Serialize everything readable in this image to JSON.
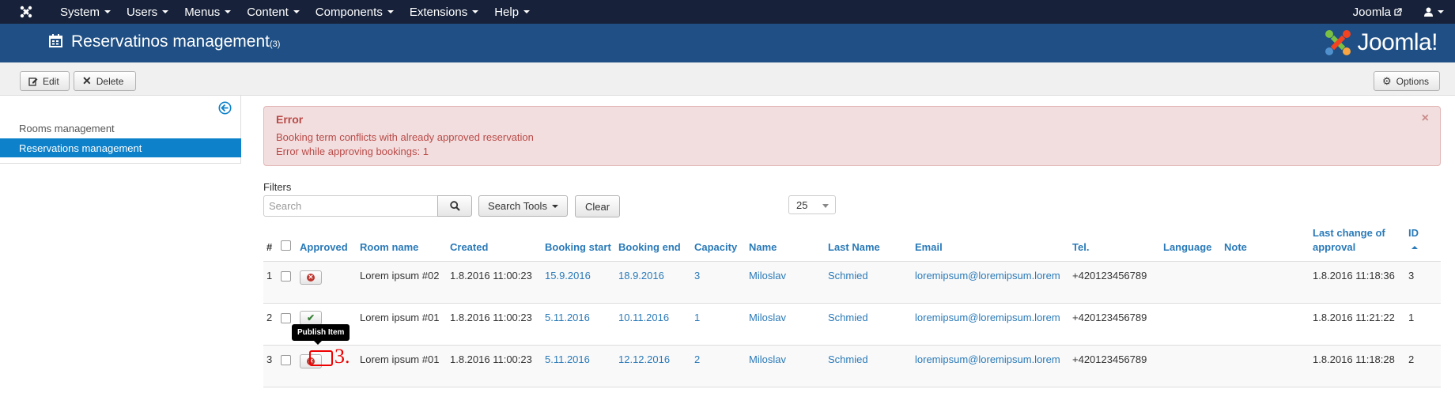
{
  "navbar": {
    "menu": [
      "System",
      "Users",
      "Menus",
      "Content",
      "Components",
      "Extensions",
      "Help"
    ],
    "site_link": "Joomla",
    "user_icon": "user-icon"
  },
  "header": {
    "title": "Reservatinos management",
    "count": "(3)",
    "brand": "Joomla!"
  },
  "toolbar": {
    "edit_label": "Edit",
    "delete_label": "Delete",
    "options_label": "Options"
  },
  "sidebar": {
    "items": [
      {
        "label": "Rooms management",
        "active": false
      },
      {
        "label": "Reservations management",
        "active": true
      }
    ]
  },
  "alert": {
    "heading": "Error",
    "messages": [
      "Booking term conflicts with already approved reservation",
      "Error while approving bookings: 1"
    ],
    "close": "×"
  },
  "filters": {
    "label": "Filters",
    "search_placeholder": "Search",
    "search_tools_label": "Search Tools",
    "clear_label": "Clear",
    "limit_value": "25"
  },
  "table": {
    "headers": [
      "#",
      "",
      "Approved",
      "Room name",
      "Created",
      "Booking start",
      "Booking end",
      "Capacity",
      "Name",
      "Last Name",
      "Email",
      "Tel.",
      "Language",
      "Note",
      "Last change of approval",
      "ID"
    ],
    "rows": [
      {
        "num": "1",
        "approved": false,
        "room": "Lorem ipsum #02",
        "created": "1.8.2016 11:00:23",
        "start": "15.9.2016",
        "end": "18.9.2016",
        "capacity": "3",
        "name": "Miloslav",
        "last_name": "Schmied",
        "email": "loremipsum@loremipsum.lorem",
        "tel": "+420123456789",
        "language": "",
        "note": "",
        "last_change": "1.8.2016 11:18:36",
        "id": "3"
      },
      {
        "num": "2",
        "approved": true,
        "room": "Lorem ipsum #01",
        "created": "1.8.2016 11:00:23",
        "start": "5.11.2016",
        "end": "10.11.2016",
        "capacity": "1",
        "name": "Miloslav",
        "last_name": "Schmied",
        "email": "loremipsum@loremipsum.lorem",
        "tel": "+420123456789",
        "language": "",
        "note": "",
        "last_change": "1.8.2016 11:21:22",
        "id": "1"
      },
      {
        "num": "3",
        "approved": false,
        "room": "Lorem ipsum #01",
        "created": "1.8.2016 11:00:23",
        "start": "5.11.2016",
        "end": "12.12.2016",
        "capacity": "2",
        "name": "Miloslav",
        "last_name": "Schmied",
        "email": "loremipsum@loremipsum.lorem",
        "tel": "+420123456789",
        "language": "",
        "note": "",
        "last_change": "1.8.2016 11:18:28",
        "id": "2"
      }
    ]
  },
  "tooltip": "Publish Item",
  "annotation": "3.",
  "colors": {
    "navbar": "#17223a",
    "header": "#1f4f84",
    "active": "#0d81c9",
    "error": "#b94a48",
    "annotation": "#e00000"
  }
}
